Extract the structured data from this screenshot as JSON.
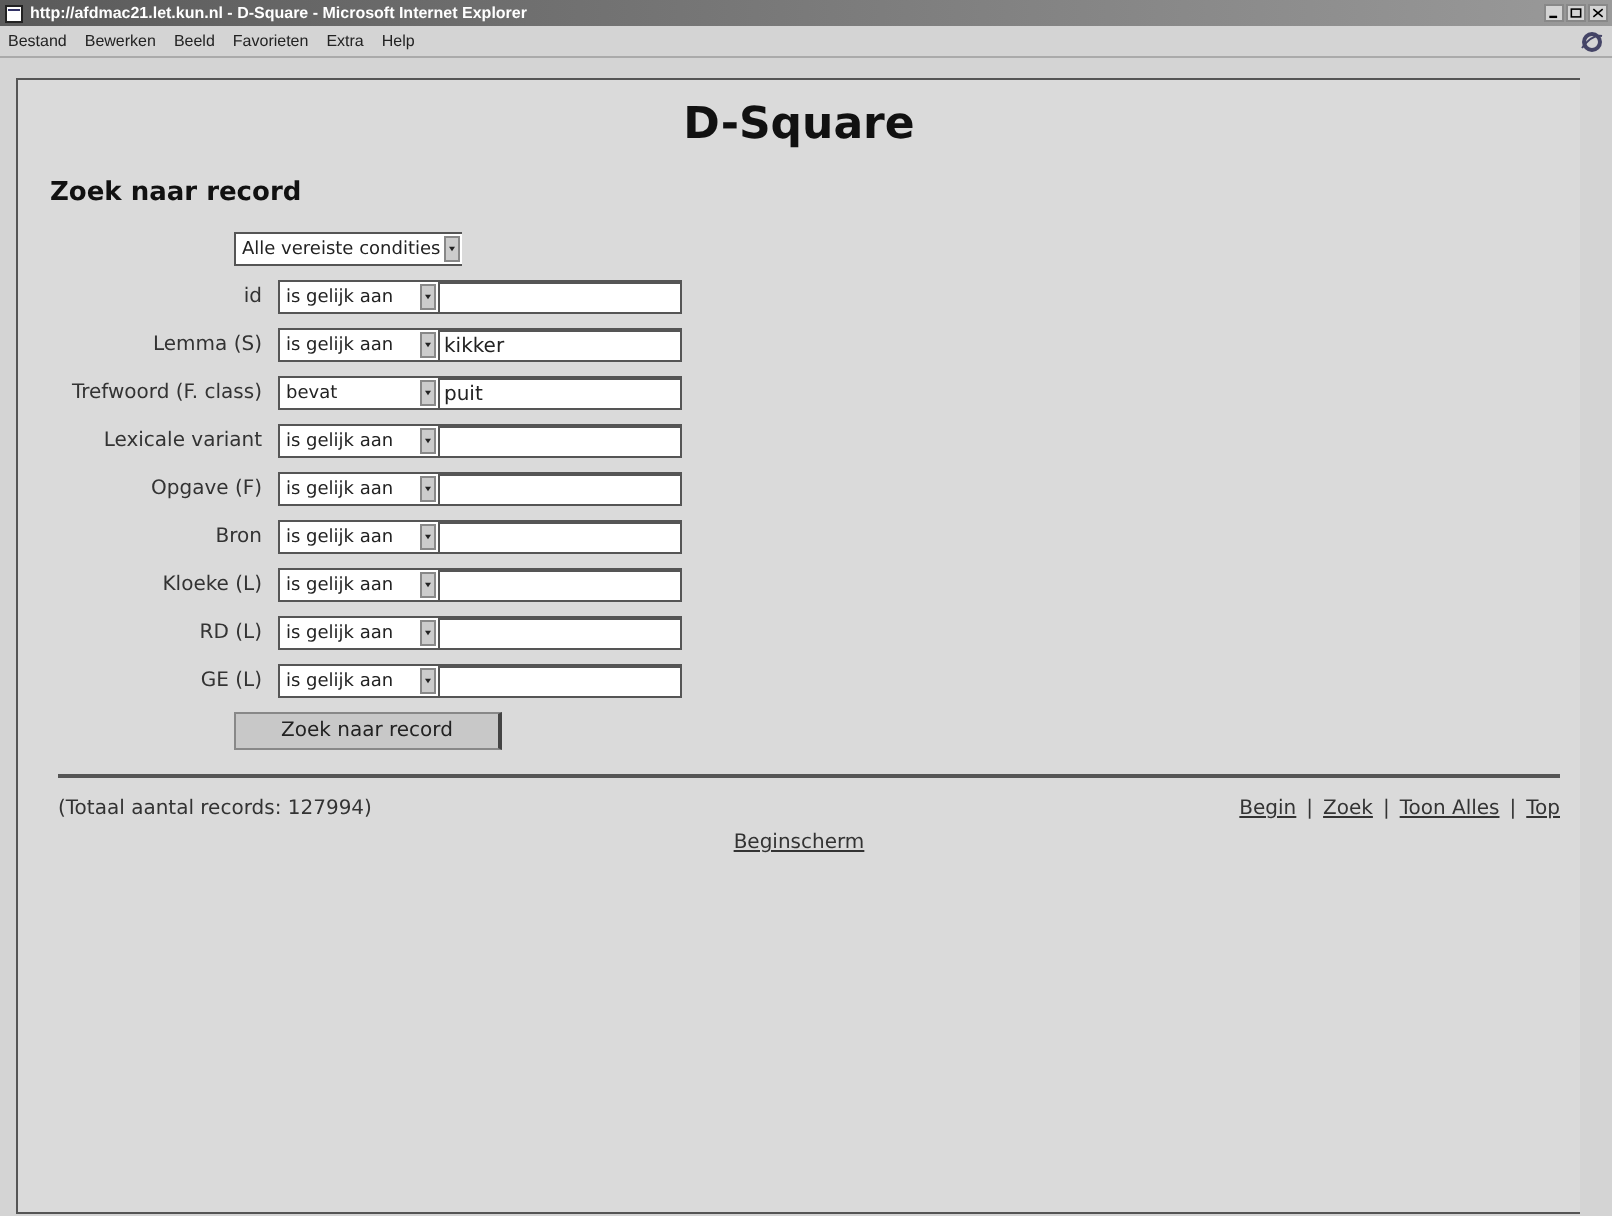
{
  "window": {
    "title": "http://afdmac21.let.kun.nl - D-Square - Microsoft Internet Explorer"
  },
  "menu": [
    "Bestand",
    "Bewerken",
    "Beeld",
    "Favorieten",
    "Extra",
    "Help"
  ],
  "page": {
    "heading": "D-Square",
    "subheading": "Zoek naar record",
    "match_select": "Alle vereiste condities",
    "fields": [
      {
        "label": "id",
        "operator": "is gelijk aan"
      },
      {
        "label": "Lemma (S)",
        "operator": "is gelijk aan",
        "value": "kikker"
      },
      {
        "label": "Trefwoord (F. class)",
        "operator": "bevat",
        "value": "puit"
      },
      {
        "label": "Lexicale variant",
        "operator": "is gelijk aan"
      },
      {
        "label": "Opgave (F)",
        "operator": "is gelijk aan"
      },
      {
        "label": "Bron",
        "operator": "is gelijk aan"
      },
      {
        "label": "Kloeke (L)",
        "operator": "is gelijk aan"
      },
      {
        "label": "RD (L)",
        "operator": "is gelijk aan"
      },
      {
        "label": "GE (L)",
        "operator": "is gelijk aan"
      }
    ],
    "submit": "Zoek naar record",
    "total": "(Totaal aantal records: 127994)",
    "nav": [
      {
        "kind": "link",
        "text": "Begin"
      },
      {
        "kind": "separator",
        "text": "|"
      },
      {
        "kind": "link",
        "text": "Zoek"
      },
      {
        "kind": "separator",
        "text": "|"
      },
      {
        "kind": "link",
        "text": "Toon Alles"
      },
      {
        "kind": "separator",
        "text": "|"
      },
      {
        "kind": "link",
        "text": "Top"
      }
    ],
    "home_link": "Beginscherm"
  }
}
